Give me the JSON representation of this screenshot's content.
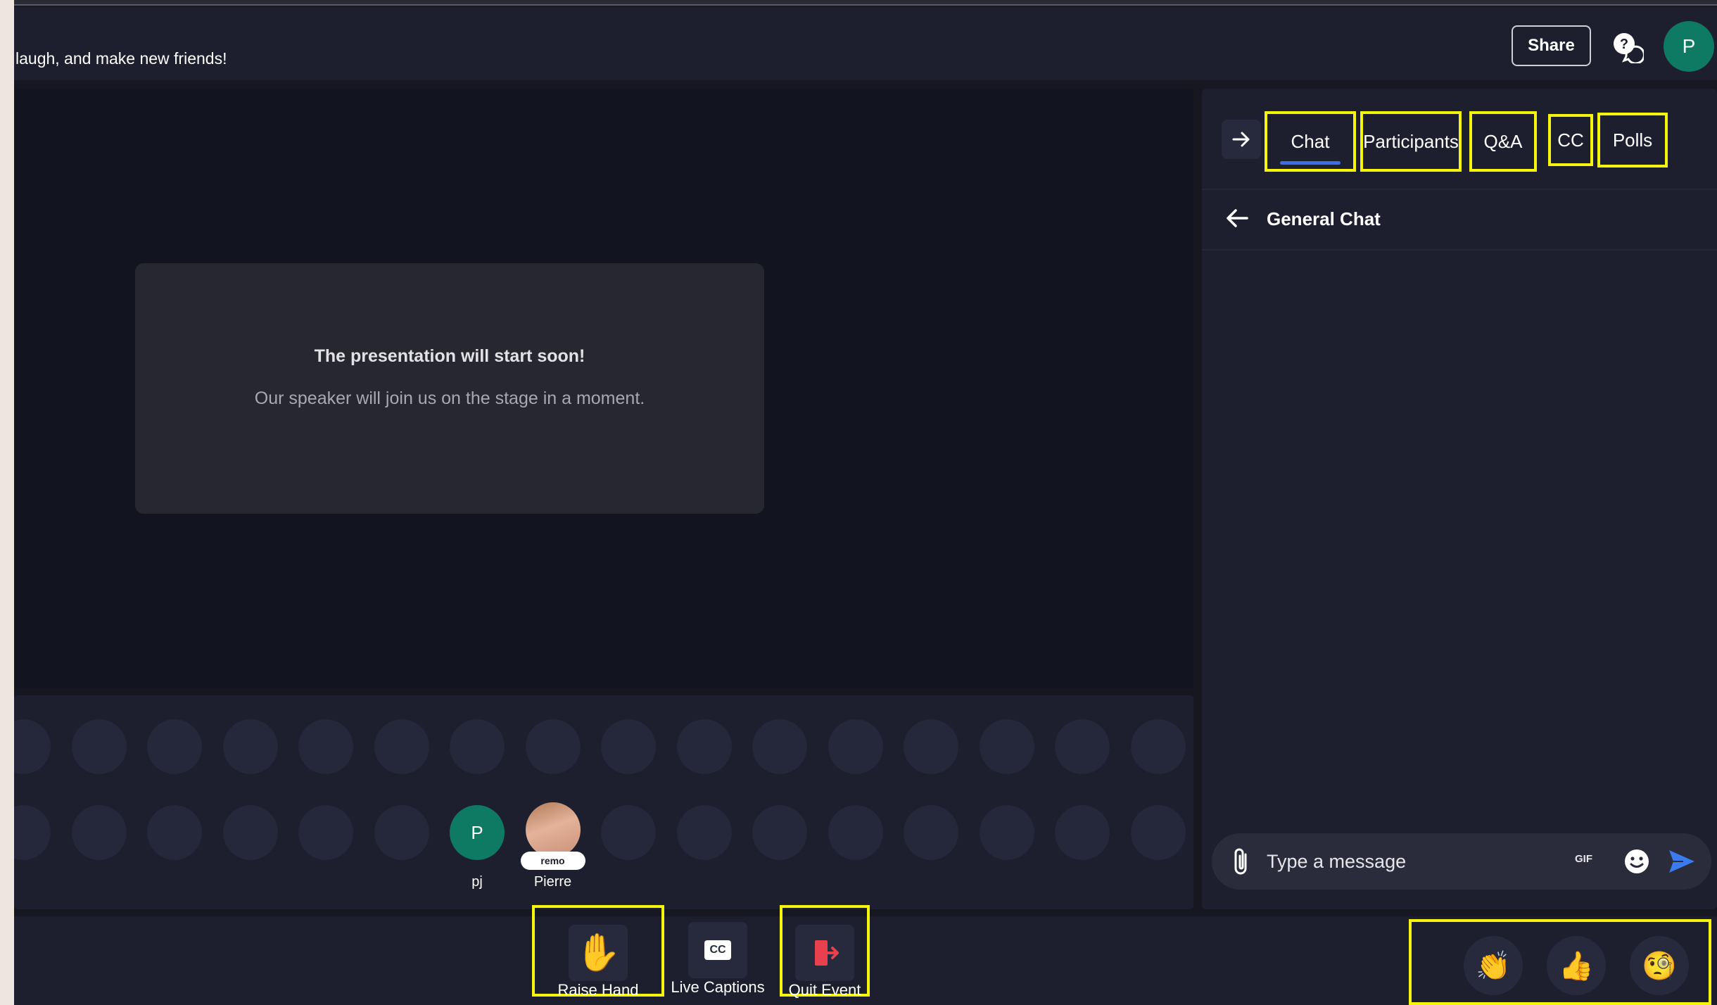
{
  "header": {
    "description": "laugh, and make new friends!",
    "share_label": "Share",
    "help_icon": "help-chat-icon",
    "user_initial": "P"
  },
  "stage": {
    "title": "The presentation will start soon!",
    "subtitle": "Our speaker will join us on the stage in a moment."
  },
  "audience": {
    "members": [
      {
        "initial": "P",
        "name": "pj"
      },
      {
        "initial": "",
        "name": "Pierre",
        "badge": "remo"
      }
    ]
  },
  "sidebar": {
    "tabs": [
      {
        "label": "Chat",
        "active": true
      },
      {
        "label": "Participants",
        "active": false
      },
      {
        "label": "Q&A",
        "active": false
      },
      {
        "label": "CC",
        "active": false
      },
      {
        "label": "Polls",
        "active": false
      }
    ],
    "chat_title": "General Chat",
    "message_placeholder": "Type a message",
    "gif_label": "GIF"
  },
  "toolbar": {
    "raise_hand_label": "Raise Hand",
    "live_captions_label": "Live Captions",
    "captions_icon_text": "CC",
    "quit_event_label": "Quit Event"
  },
  "reactions": [
    {
      "name": "clap",
      "glyph": "👏"
    },
    {
      "name": "thumbs-up",
      "glyph": "👍"
    },
    {
      "name": "monocle",
      "glyph": "🧐"
    }
  ],
  "colors": {
    "highlight": "#f5f50c",
    "accent": "#3a6ee8",
    "avatar_green": "#0f7a63",
    "quit_red": "#e8414d"
  }
}
